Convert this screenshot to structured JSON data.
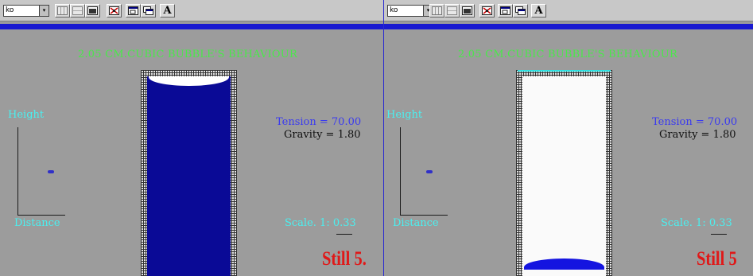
{
  "toolbar": {
    "zoom_value": "ko",
    "dropdown_arrow": "▾",
    "text_button_label": "A"
  },
  "simulation": {
    "title": "2.05 CM.CUBIC BUBBLE'S BEHAVIOUR",
    "height_label": "Height",
    "distance_label": "Distance",
    "tension": "Tension = 70.00",
    "gravity": "Gravity = 1.80",
    "scale": "Scale. 1: 0.33"
  },
  "panels": [
    {
      "still_label": "Still 5."
    },
    {
      "still_label": "Still 5"
    }
  ],
  "colors": {
    "title_green": "#4ae84a",
    "label_cyan": "#4af0f0",
    "tension_blue": "#3a3af0",
    "liquid_blue": "#0a0a96",
    "still_red": "#e01818",
    "background_gray": "#9c9c9c"
  },
  "icons": [
    "zoom-dropdown-icon",
    "grid-icon",
    "grid-small-icon",
    "table-icon",
    "crosshair-icon",
    "window-icon",
    "cascade-icon",
    "text-icon"
  ]
}
